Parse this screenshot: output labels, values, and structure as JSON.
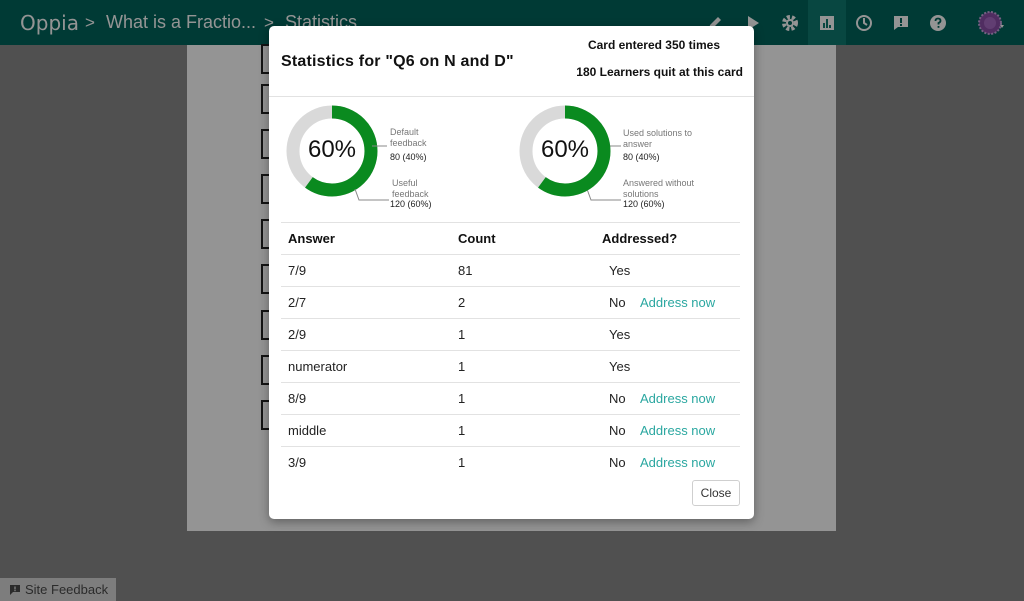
{
  "navbar": {
    "brand": "Oppia",
    "separator": ">",
    "breadcrumbs": [
      "What is a Fractio...",
      "Statistics"
    ],
    "icons": [
      "pencil-icon",
      "play-icon",
      "gear-icon",
      "stats-icon",
      "history-icon",
      "feedback-icon",
      "help-icon",
      "avatar"
    ],
    "active_icon": "stats-icon",
    "color": "#00645c"
  },
  "site_feedback": {
    "label": "Site Feedback"
  },
  "modal": {
    "title": "Statistics for \"Q6 on N and D\"",
    "card_entered": "Card entered 350 times",
    "learners_quit": "180 Learners quit at this card",
    "donut_left": {
      "percent_label": "60%",
      "fill_fraction": 0.6,
      "segments": [
        {
          "label_line1": "Default",
          "label_line2": "feedback",
          "value": "80 (40%)"
        },
        {
          "label_line1": "Useful",
          "label_line2": "feedback",
          "value": "120 (60%)"
        }
      ]
    },
    "donut_right": {
      "percent_label": "60%",
      "fill_fraction": 0.6,
      "segments": [
        {
          "label_line1": "Used solutions to",
          "label_line2": "answer",
          "value": "80 (40%)"
        },
        {
          "label_line1": "Answered without",
          "label_line2": "solutions",
          "value": "120 (60%)"
        }
      ]
    },
    "colors": {
      "primary": "#0a8a1f",
      "secondary": "#d9d9d9",
      "link": "#2aa7a0"
    },
    "table": {
      "headers": [
        "Answer",
        "Count",
        "Addressed?"
      ],
      "address_link": "Address now",
      "rows": [
        {
          "answer": "7/9",
          "count": "81",
          "addressed": "Yes"
        },
        {
          "answer": "2/7",
          "count": "2",
          "addressed": "No"
        },
        {
          "answer": "2/9",
          "count": "1",
          "addressed": "Yes"
        },
        {
          "answer": "numerator",
          "count": "1",
          "addressed": "Yes"
        },
        {
          "answer": "8/9",
          "count": "1",
          "addressed": "No"
        },
        {
          "answer": "middle",
          "count": "1",
          "addressed": "No"
        },
        {
          "answer": "3/9",
          "count": "1",
          "addressed": "No"
        }
      ]
    },
    "close_label": "Close"
  }
}
